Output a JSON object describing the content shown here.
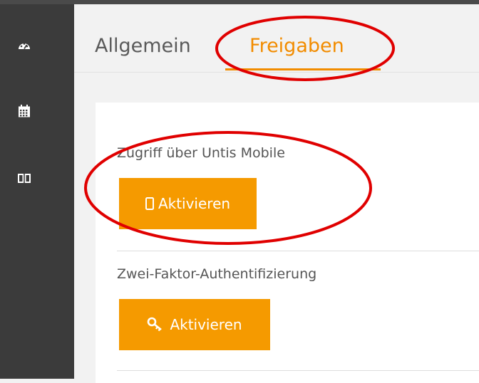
{
  "sidebar": {
    "items": [
      {
        "icon": "dashboard-icon"
      },
      {
        "icon": "calendar-icon"
      },
      {
        "icon": "book-icon"
      }
    ]
  },
  "tabs": [
    {
      "label": "Allgemein",
      "active": false
    },
    {
      "label": "Freigaben",
      "active": true
    }
  ],
  "sections": [
    {
      "label": "Zugriff über Untis Mobile",
      "button_label": "Aktivieren",
      "button_icon": "mobile-phone-icon"
    },
    {
      "label": "Zwei-Faktor-Authentifizierung",
      "button_label": "Aktivieren",
      "button_icon": "key-icon"
    }
  ],
  "colors": {
    "accent": "#f28c00",
    "button": "#f59a00",
    "sidebar": "#3b3b3b",
    "annotation": "#e00000"
  }
}
